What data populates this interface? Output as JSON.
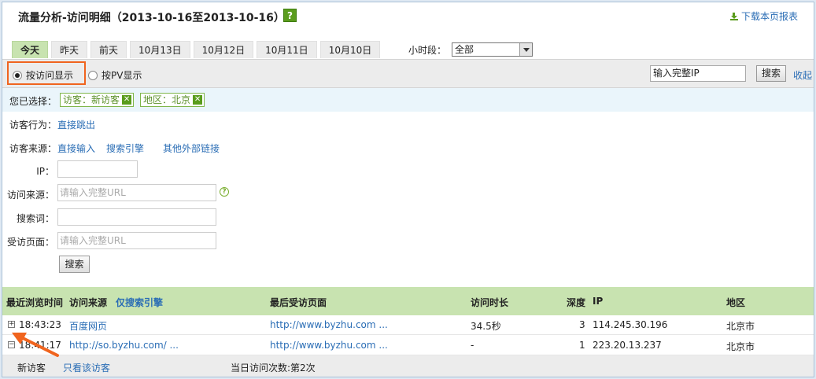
{
  "header": {
    "title": "流量分析-访问明细（2013-10-16至2013-10-16）",
    "help": "?",
    "download": "下载本页报表"
  },
  "tabs": [
    "今天",
    "昨天",
    "前天",
    "10月13日",
    "10月12日",
    "10月11日",
    "10月10日"
  ],
  "active_tab": "今天",
  "period": {
    "label": "小时段：",
    "value": "全部"
  },
  "mode": {
    "by_visit": "按访问显示",
    "by_pv": "按PV显示",
    "selected": "按访问显示"
  },
  "ip_search": {
    "value": "输入完整IP",
    "button": "搜索",
    "collapse": "收起"
  },
  "selected_filters": {
    "label": "您已选择：",
    "chips": [
      {
        "text": "访客：新访客",
        "x": "✕"
      },
      {
        "text": "地区：北京",
        "x": "✕"
      }
    ]
  },
  "filters": {
    "behavior": {
      "label": "访客行为：",
      "options": [
        "直接跳出"
      ]
    },
    "source": {
      "label": "访客来源：",
      "options": [
        "直接输入",
        "搜索引擎",
        "其他外部链接"
      ]
    },
    "ip": {
      "label": "IP：",
      "placeholder": ""
    },
    "referrer": {
      "label": "访问来源：",
      "placeholder": "请输入完整URL"
    },
    "keyword": {
      "label": "搜索词：",
      "placeholder": ""
    },
    "landing": {
      "label": "受访页面：",
      "placeholder": "请输入完整URL"
    },
    "help": "?",
    "search_button": "搜索"
  },
  "table": {
    "headers": {
      "time": "最近浏览时间",
      "source": "访问来源",
      "source_filter": "仅搜索引擎",
      "last_page": "最后受访页面",
      "duration": "访问时长",
      "depth": "深度",
      "ip": "IP",
      "region": "地区"
    },
    "rows": [
      {
        "expander": "+",
        "time": "18:43:23",
        "source": "百度网页",
        "last_page": "http://www.byzhu.com ...",
        "duration": "34.5秒",
        "depth": "3",
        "ip": "114.245.30.196",
        "region": "北京市"
      },
      {
        "expander": "−",
        "time": "18:41:17",
        "source": "http://so.byzhu.com/ ...",
        "last_page": "http://www.byzhu.com ...",
        "duration": "-",
        "depth": "1",
        "ip": "223.20.13.237",
        "region": "北京市"
      }
    ],
    "subrow": {
      "visitor_type": "新访客",
      "only_this": "只看该访客",
      "visit_count": "当日访问次数:第2次"
    }
  },
  "colors": {
    "accent_green": "#c8e3b0",
    "link": "#2a6db5",
    "highlight": "#f0641e"
  }
}
